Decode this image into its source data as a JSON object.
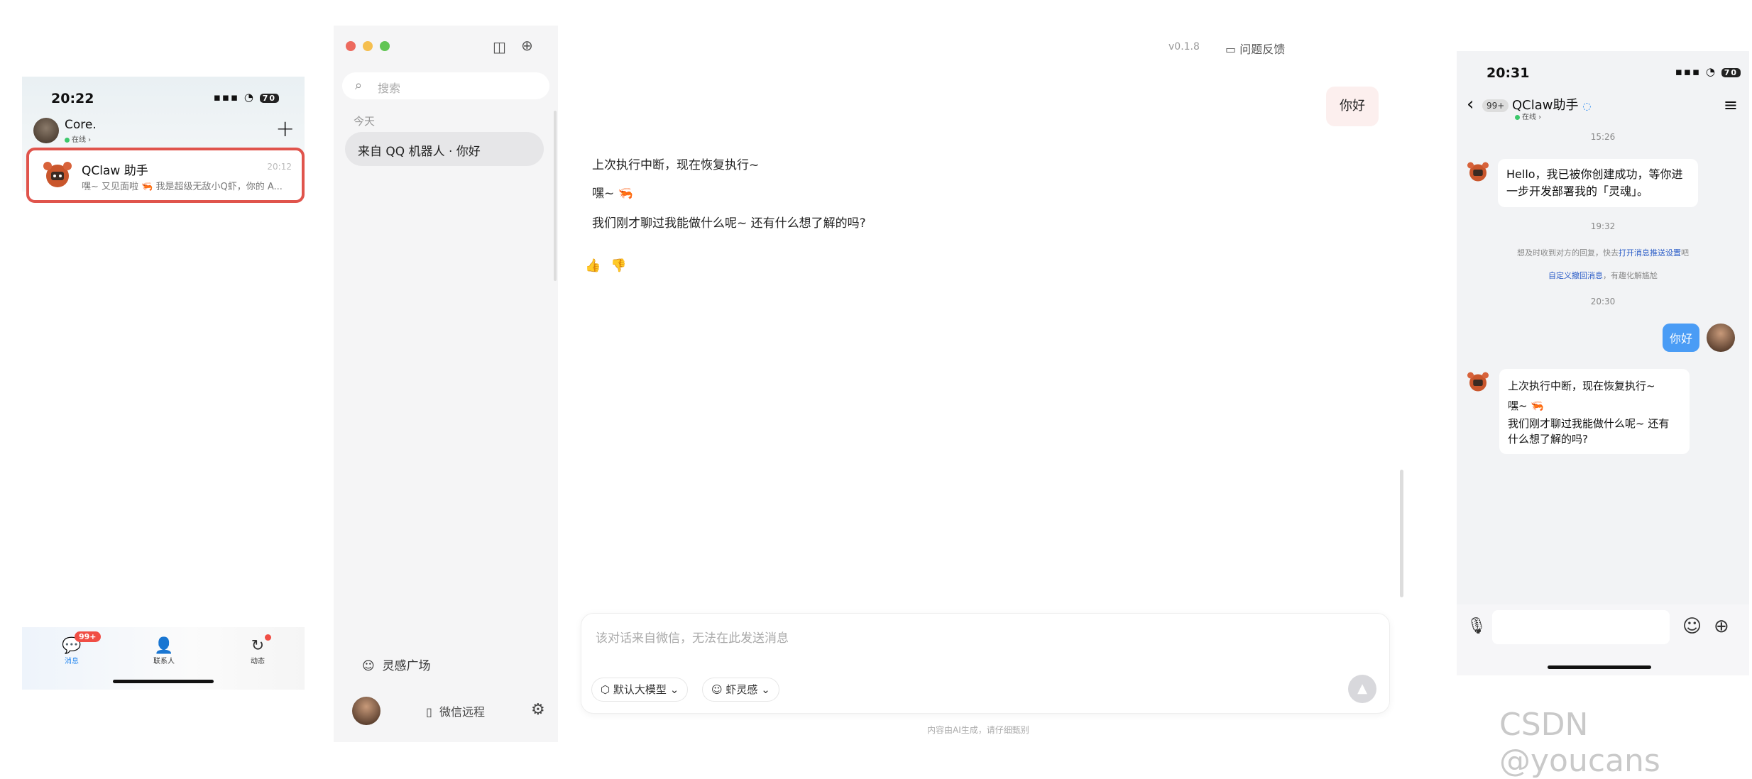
{
  "phone_left": {
    "status_time": "20:22",
    "battery": "70",
    "user_name": "Core.",
    "user_status": "在线",
    "chat_item": {
      "title": "QClaw 助手",
      "time": "20:12",
      "preview": "嘿~ 又见面啦 🦐 我是超级无敌小Q虾，你的 A..."
    },
    "tabs": [
      {
        "label": "消息",
        "badge": "99+"
      },
      {
        "label": "联系人"
      },
      {
        "label": "动态"
      }
    ]
  },
  "desktop": {
    "search_placeholder": "搜索",
    "section_today": "今天",
    "conversation": "来自 QQ 机器人 · 你好",
    "inspiration": "灵感广场",
    "wechat_remote": "微信远程",
    "version": "v0.1.8",
    "feedback": "问题反馈",
    "user_bubble": "你好",
    "messages": [
      "上次执行中断，现在恢复执行~",
      "嘿~ 🦐",
      "我们刚才聊过我能做什么呢~ 还有什么想了解的吗?"
    ],
    "input_placeholder": "该对话来自微信，无法在此发送消息",
    "model_chip": "默认大模型",
    "skill_chip": "虾灵感",
    "disclaimer": "内容由AI生成，请仔细甄别"
  },
  "phone_right": {
    "status_time": "20:31",
    "battery": "70",
    "back_count": "99+",
    "title": "QClaw助手",
    "status": "在线",
    "ts1": "15:26",
    "bot_msg1_line1": "Hello，我已被你创建成功，等你进",
    "bot_msg1_line2": "一步开发部署我的「灵魂」。",
    "ts2": "19:32",
    "sys1_pre": "想及时收到对方的回复，快去",
    "sys1_link": "打开消息推送设置",
    "sys1_post": "吧",
    "sys2_link": "自定义撤回消息",
    "sys2_post": "，有趣化解尴尬",
    "ts3": "20:30",
    "user_msg": "你好",
    "bot_msg2_l1": "上次执行中断，现在恢复执行~",
    "bot_msg2_l2": "嘿~ 🦐",
    "bot_msg2_l3": "我们刚才聊过我能做什么呢~ 还有",
    "bot_msg2_l4": "什么想了解的吗?"
  },
  "watermark": "CSDN @youcans",
  "icons": [
    "search-icon",
    "plus-icon",
    "sidebar-toggle-icon",
    "new-chat-icon",
    "thumbs-up-icon",
    "thumbs-down-icon",
    "gear-icon",
    "phone-icon",
    "sparkle-icon",
    "send-icon",
    "mic-icon",
    "emoji-icon",
    "back-icon",
    "menu-icon"
  ]
}
